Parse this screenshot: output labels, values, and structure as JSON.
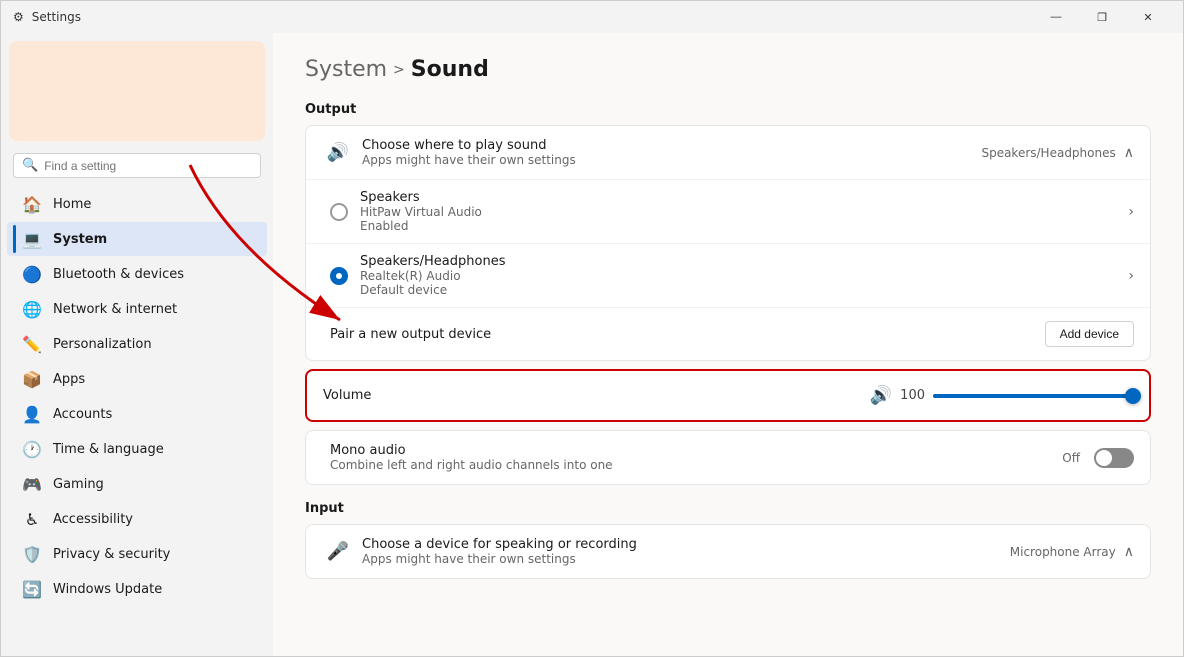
{
  "window": {
    "title": "Settings",
    "controls": {
      "minimize": "—",
      "maximize": "❐",
      "close": "✕"
    }
  },
  "sidebar": {
    "search_placeholder": "Find a setting",
    "profile_bg": "#fde8d8",
    "nav_items": [
      {
        "id": "home",
        "label": "Home",
        "icon": "🏠",
        "active": false
      },
      {
        "id": "system",
        "label": "System",
        "icon": "💻",
        "active": true
      },
      {
        "id": "bluetooth",
        "label": "Bluetooth & devices",
        "icon": "🔵",
        "active": false
      },
      {
        "id": "network",
        "label": "Network & internet",
        "icon": "🌐",
        "active": false
      },
      {
        "id": "personalization",
        "label": "Personalization",
        "icon": "✏️",
        "active": false
      },
      {
        "id": "apps",
        "label": "Apps",
        "icon": "📦",
        "active": false
      },
      {
        "id": "accounts",
        "label": "Accounts",
        "icon": "👤",
        "active": false
      },
      {
        "id": "time",
        "label": "Time & language",
        "icon": "🕐",
        "active": false
      },
      {
        "id": "gaming",
        "label": "Gaming",
        "icon": "🎮",
        "active": false
      },
      {
        "id": "accessibility",
        "label": "Accessibility",
        "icon": "♿",
        "active": false
      },
      {
        "id": "privacy",
        "label": "Privacy & security",
        "icon": "🛡️",
        "active": false
      },
      {
        "id": "update",
        "label": "Windows Update",
        "icon": "🔄",
        "active": false
      }
    ]
  },
  "breadcrumb": {
    "parent": "System",
    "separator": ">",
    "current": "Sound"
  },
  "output_section": {
    "title": "Output",
    "choose_row": {
      "label": "Choose where to play sound",
      "sublabel": "Apps might have their own settings",
      "value": "Speakers/Headphones"
    },
    "devices": [
      {
        "id": "speakers",
        "label": "Speakers",
        "sublabel": "HitPaw Virtual Audio",
        "status": "Enabled",
        "selected": false
      },
      {
        "id": "speakers-headphones",
        "label": "Speakers/Headphones",
        "sublabel": "Realtek(R) Audio",
        "status": "Default device",
        "selected": true
      }
    ],
    "pair_row": {
      "label": "Pair a new output device",
      "button_label": "Add device"
    },
    "volume_row": {
      "label": "Volume",
      "icon": "🔊",
      "value": 100,
      "highlighted": true
    },
    "mono_audio": {
      "label": "Mono audio",
      "sublabel": "Combine left and right audio channels into one",
      "toggle_state": "Off"
    }
  },
  "input_section": {
    "title": "Input",
    "choose_row": {
      "label": "Choose a device for speaking or recording",
      "sublabel": "Apps might have their own settings",
      "value": "Microphone Array"
    }
  }
}
